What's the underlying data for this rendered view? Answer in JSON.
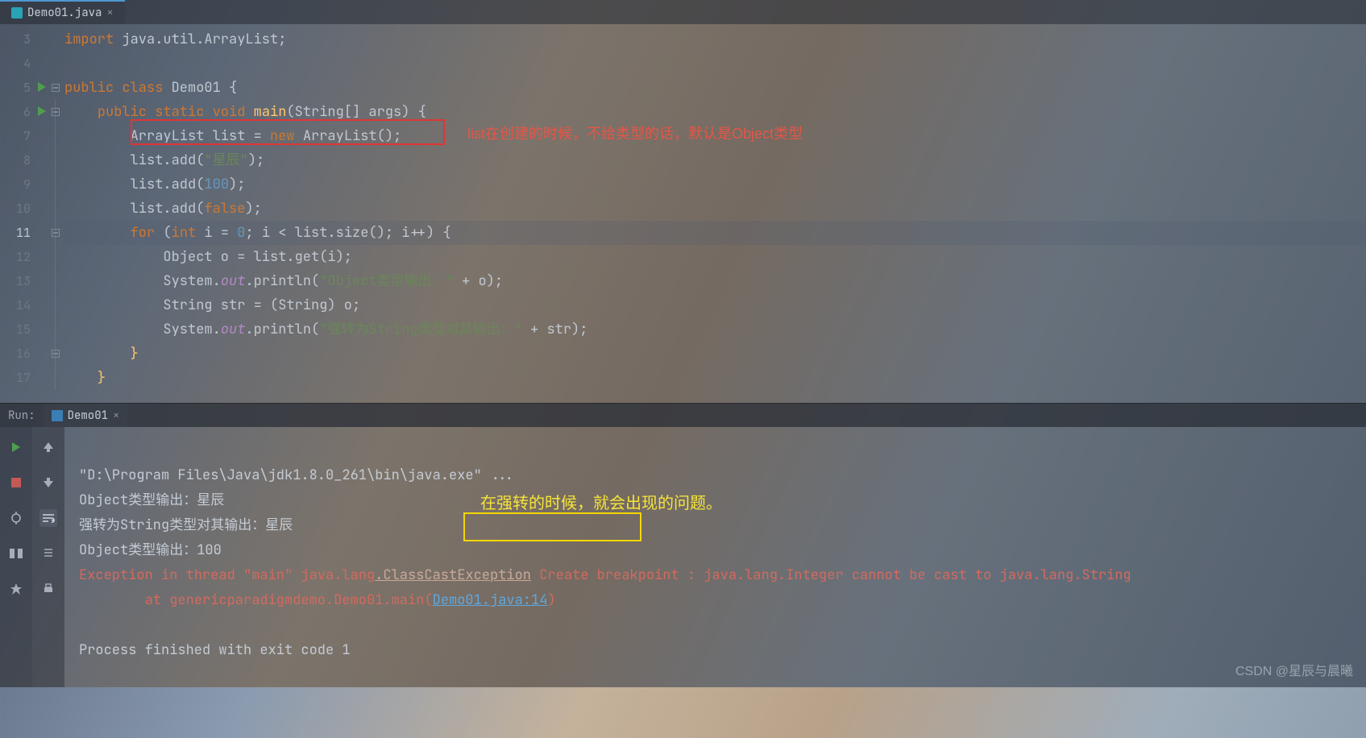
{
  "tab": {
    "filename": "Demo01.java"
  },
  "gutter": {
    "lines": [
      3,
      4,
      5,
      6,
      7,
      8,
      9,
      10,
      11,
      12,
      13,
      14,
      15,
      16,
      17
    ],
    "highlighted": 11,
    "run_markers": [
      5,
      6
    ]
  },
  "code": {
    "l3": {
      "kw": "import",
      "rest": " java.util.ArrayList;"
    },
    "l5": {
      "kw1": "public class",
      "cls": " Demo01 ",
      "brace": "{"
    },
    "l6": {
      "kw1": "public static void",
      "fn": " main",
      "sig": "(String[] args) {"
    },
    "l7": {
      "t": "ArrayList list = ",
      "kw": "new",
      "t2": " ArrayList();"
    },
    "l8": {
      "t1": "list.add(",
      "s": "\"星辰\"",
      "t2": ");"
    },
    "l9": {
      "t1": "list.add(",
      "n": "100",
      "t2": ");"
    },
    "l10": {
      "t1": "list.add(",
      "kw": "false",
      "t2": ");"
    },
    "l11": {
      "kw1": "for ",
      "paren": "(",
      "kw2": "int",
      "t1": " i = ",
      "n0": "0",
      "t2": "; i < list.size(); i++) {"
    },
    "l12": {
      "t": "Object o = list.get(i);"
    },
    "l13": {
      "t1": "System.",
      "f": "out",
      "t2": ".println(",
      "s": "\"Object类型输出：\"",
      "t3": " + o);"
    },
    "l14": {
      "t": "String str = (String) o;"
    },
    "l15": {
      "t1": "System.",
      "f": "out",
      "t2": ".println(",
      "s": "\"强转为String类型对其输出：\"",
      "t3": " + str);"
    },
    "l16": {
      "brace": "}"
    },
    "l17": {
      "brace": "}"
    }
  },
  "annotations": {
    "red": "list在创建的时候，不给类型的话，默认是Object类型",
    "yellow": "在强转的时候，就会出现的问题。"
  },
  "run_panel": {
    "label": "Run:",
    "config": "Demo01"
  },
  "console": {
    "cmd": "\"D:\\Program Files\\Java\\jdk1.8.0_261\\bin\\java.exe\" ...",
    "o1": "Object类型输出：星辰",
    "o2": "强转为String类型对其输出：星辰",
    "o3": "Object类型输出：100",
    "err_prefix": "Exception in thread \"main\" java.lang",
    "err_class": ".ClassCastException",
    "err_suffix": " Create breakpoint : java.lang.Integer cannot be cast to java.lang.String",
    "at_prefix": "        at genericparadigmdemo.Demo01.main(",
    "at_link": "Demo01.java:14",
    "at_suffix": ")",
    "exit": "Process finished with exit code 1"
  },
  "watermark": "CSDN @星辰与晨曦"
}
